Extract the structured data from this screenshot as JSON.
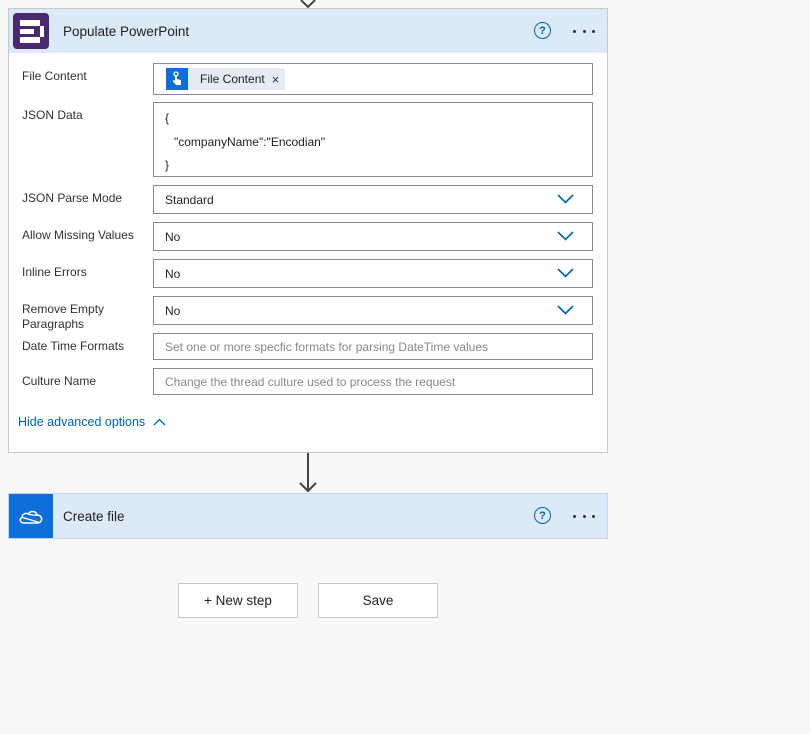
{
  "colors": {
    "header_bg": "#dbe9f9",
    "accent": "#0063b1",
    "encodian_icon_bg": "#4a2a6e",
    "onedrive_icon_bg": "#0f6fd9"
  },
  "populate_card": {
    "title": "Populate PowerPoint",
    "icon": "encodian-logo",
    "fields": {
      "file_content": {
        "label": "File Content",
        "token_label": "File Content",
        "token_icon": "touch-icon",
        "token_remove": "×"
      },
      "json_data": {
        "label": "JSON Data",
        "lines": [
          "{",
          "\"companyName\":\"Encodian\"",
          "}"
        ]
      },
      "json_parse_mode": {
        "label": "JSON Parse Mode",
        "value": "Standard"
      },
      "allow_missing_values": {
        "label": "Allow Missing Values",
        "value": "No"
      },
      "inline_errors": {
        "label": "Inline Errors",
        "value": "No"
      },
      "remove_empty_paragraphs": {
        "label": "Remove Empty Paragraphs",
        "value": "No"
      },
      "date_time_formats": {
        "label": "Date Time Formats",
        "placeholder": "Set one or more specfic formats for parsing DateTime values"
      },
      "culture_name": {
        "label": "Culture Name",
        "placeholder": "Change the thread culture used to process the request"
      }
    },
    "advanced_toggle": "Hide advanced options"
  },
  "create_file_card": {
    "title": "Create file",
    "icon": "onedrive-icon"
  },
  "actions": {
    "new_step": "+ New step",
    "save": "Save"
  }
}
